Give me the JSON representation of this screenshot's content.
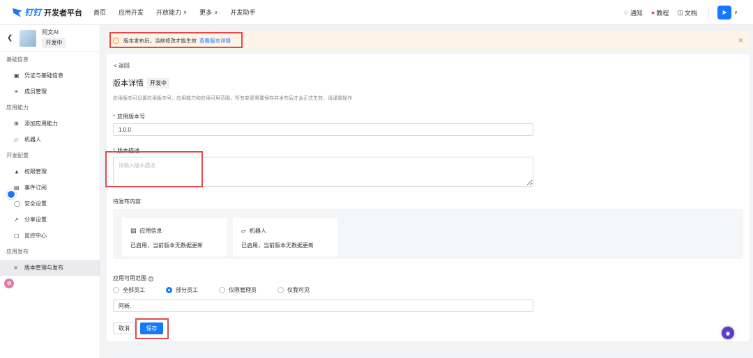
{
  "header": {
    "brand": "钉钉",
    "title": "开发者平台",
    "nav": [
      {
        "label": "首页",
        "has_menu": false
      },
      {
        "label": "应用开发",
        "has_menu": false
      },
      {
        "label": "开放能力",
        "has_menu": true
      },
      {
        "label": "更多",
        "has_menu": true
      },
      {
        "label": "开发助手",
        "has_menu": false
      }
    ],
    "right": {
      "notify": "通知",
      "tutorial": "教程",
      "docs": "文档"
    }
  },
  "sidebar": {
    "app_name": "阿文AI",
    "app_status": "开发中",
    "groups": [
      {
        "title": "基础信息",
        "items": [
          {
            "label": "凭证与基础信息",
            "icon": "document-icon"
          },
          {
            "label": "成员管理",
            "icon": "user-icon"
          }
        ]
      },
      {
        "title": "应用能力",
        "items": [
          {
            "label": "添加应用能力",
            "icon": "grid-icon"
          },
          {
            "label": "机器人",
            "icon": "robot-icon"
          }
        ]
      },
      {
        "title": "开发配置",
        "items": [
          {
            "label": "权限管理",
            "icon": "lock-icon"
          },
          {
            "label": "事件订阅",
            "icon": "event-icon"
          },
          {
            "label": "安全设置",
            "icon": "shield-icon"
          },
          {
            "label": "分享设置",
            "icon": "share-icon"
          },
          {
            "label": "监控中心",
            "icon": "monitor-icon"
          }
        ]
      },
      {
        "title": "应用发布",
        "items": [
          {
            "label": "版本管理与发布",
            "icon": "layers-icon",
            "active": true
          }
        ]
      }
    ]
  },
  "alert": {
    "text": "版本发布后，当前修改才能生效",
    "link": "查看版本详情"
  },
  "main": {
    "back": "返回",
    "title": "版本详情",
    "status": "开发中",
    "description": "应用版本可设置应用版本号、应用能力和应用可用范围，所有变更需要保存并发布后才会正式生效，请谨慎操作",
    "version_label": "应用版本号",
    "version_value": "1.0.0",
    "desc_label": "版本描述",
    "desc_placeholder": "请输入版本描述",
    "pending_label": "待发布内容",
    "pending_cards": [
      {
        "title": "应用信息",
        "icon": "app-window-icon",
        "desc": "已启用，当前版本无数据更新"
      },
      {
        "title": "机器人",
        "icon": "robot-icon",
        "desc": "已启用，当前版本无数据更新"
      }
    ],
    "scope_label": "应用可用范围",
    "scope_options": [
      {
        "label": "全部员工",
        "checked": false
      },
      {
        "label": "部分员工",
        "checked": true
      },
      {
        "label": "仅限管理员",
        "checked": false
      },
      {
        "label": "仅我可见",
        "checked": false
      }
    ],
    "scope_value": "阿新.",
    "cancel": "取消",
    "save": "保存"
  },
  "colors": {
    "primary": "#1677ff",
    "alert_bg": "#fdf3e6",
    "highlight": "#e24a4a"
  }
}
